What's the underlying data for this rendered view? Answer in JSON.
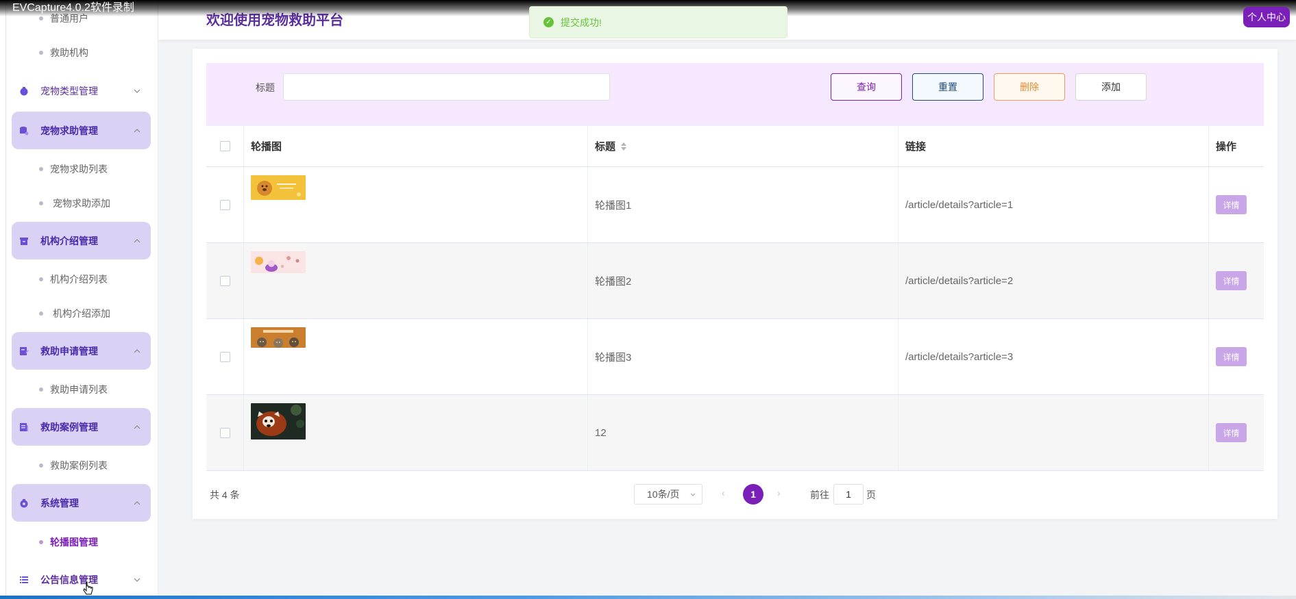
{
  "recorder": {
    "title": "EVCapture4.0.2软件录制"
  },
  "header": {
    "welcome": "欢迎使用宠物救助平台",
    "personal_center": "个人中心"
  },
  "toast": {
    "message": "提交成功!"
  },
  "sidebar": {
    "top_items": [
      "普通用户",
      "救助机构"
    ],
    "groups": [
      {
        "label": "宠物类型管理",
        "expanded": false,
        "sub": []
      },
      {
        "label": "宠物求助管理",
        "expanded": true,
        "sub": [
          "宠物求助列表",
          "宠物求助添加"
        ]
      },
      {
        "label": "机构介绍管理",
        "expanded": true,
        "sub": [
          "机构介绍列表",
          "机构介绍添加"
        ]
      },
      {
        "label": "救助申请管理",
        "expanded": true,
        "sub": [
          "救助申请列表"
        ]
      },
      {
        "label": "救助案例管理",
        "expanded": true,
        "sub": [
          "救助案例列表"
        ]
      },
      {
        "label": "系统管理",
        "expanded": true,
        "sub": [
          "轮播图管理"
        ],
        "active_sub": "轮播图管理"
      },
      {
        "label": "公告信息管理",
        "expanded": false,
        "sub": []
      }
    ]
  },
  "search": {
    "label": "标题",
    "value": "",
    "placeholder": ""
  },
  "buttons": {
    "query": "查询",
    "reset": "重置",
    "delete": "删除",
    "add": "添加"
  },
  "table": {
    "columns": [
      "轮播图",
      "标题",
      "链接",
      "操作"
    ],
    "rows": [
      {
        "title": "轮播图1",
        "link": "/article/details?article=1",
        "action": "详情",
        "image": "banner-dog-yellow"
      },
      {
        "title": "轮播图2",
        "link": "/article/details?article=2",
        "action": "详情",
        "image": "banner-pink-cats"
      },
      {
        "title": "轮播图3",
        "link": "/article/details?article=3",
        "action": "详情",
        "image": "banner-cats-orange"
      },
      {
        "title": "12",
        "link": "",
        "action": "详情",
        "image": "red-panda-photo"
      }
    ]
  },
  "pagination": {
    "total": "共 4 条",
    "page_size": "10条/页",
    "current_page": "1",
    "goto_prefix": "前往",
    "goto_value": "1",
    "goto_suffix": "页"
  },
  "colors": {
    "accent": "#7a1fb8",
    "sidebar_open": "#d9d2f5",
    "search_bg": "#f6e9ff",
    "detail_btn": "#c8a6e8",
    "toast_success": "#67c23a"
  }
}
